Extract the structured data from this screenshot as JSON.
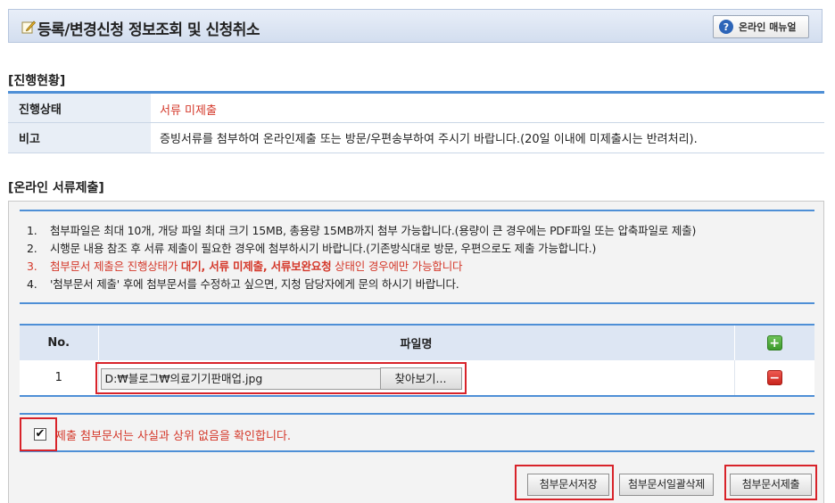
{
  "header": {
    "title": "등록/변경신청 정보조회 및 신청취소",
    "manual_label": "온라인 매뉴얼",
    "manual_icon": "?"
  },
  "progress": {
    "section_title": "[진행현황]",
    "rows": [
      {
        "label": "진행상태",
        "value": "서류 미제출"
      },
      {
        "label": "비고",
        "value": "증빙서류를 첨부하여 온라인제출 또는 방문/우편송부하여 주시기 바랍니다.(20일 이내에 미제출시는 반려처리)."
      }
    ]
  },
  "online": {
    "section_title": "[온라인 서류제출]",
    "notes": [
      {
        "num": "1.",
        "text": "첨부파일은 최대 10개, 개당 파일 최대 크기 15MB, 총용량 15MB까지 첨부 가능합니다.(용량이 큰 경우에는 PDF파일 또는 압축파일로 제출)"
      },
      {
        "num": "2.",
        "text": "시행문 내용 참조 후 서류 제출이 필요한 경우에 첨부하시기 바랍니다.(기존방식대로 방문, 우편으로도 제출 가능합니다.)"
      },
      {
        "num": "3.",
        "pre": "첨부문서 제출은 진행상태가 ",
        "bold": "대기, 서류 미제출, 서류보완요청",
        "post": " 상태인 경우에만 가능합니다"
      },
      {
        "num": "4.",
        "text": "'첨부문서 제출' 후에 첨부문서를 수정하고 싶으면, 지청 담당자에게 문의 하시기 바랍니다."
      }
    ],
    "file_table": {
      "col_no": "No.",
      "col_name": "파일명",
      "add_icon": "+",
      "rows": [
        {
          "no": "1",
          "path": "D:₩블로그₩의료기기판매업.jpg",
          "browse_label": "찾아보기...",
          "remove_icon": "−"
        }
      ]
    },
    "confirm": {
      "checked_mark": "✔",
      "text": "제출 첨부문서는 사실과 상위 없음을 확인합니다."
    },
    "buttons": {
      "save": "첨부문서저장",
      "delete_all": "첨부문서일괄삭제",
      "submit": "첨부문서제출"
    }
  }
}
